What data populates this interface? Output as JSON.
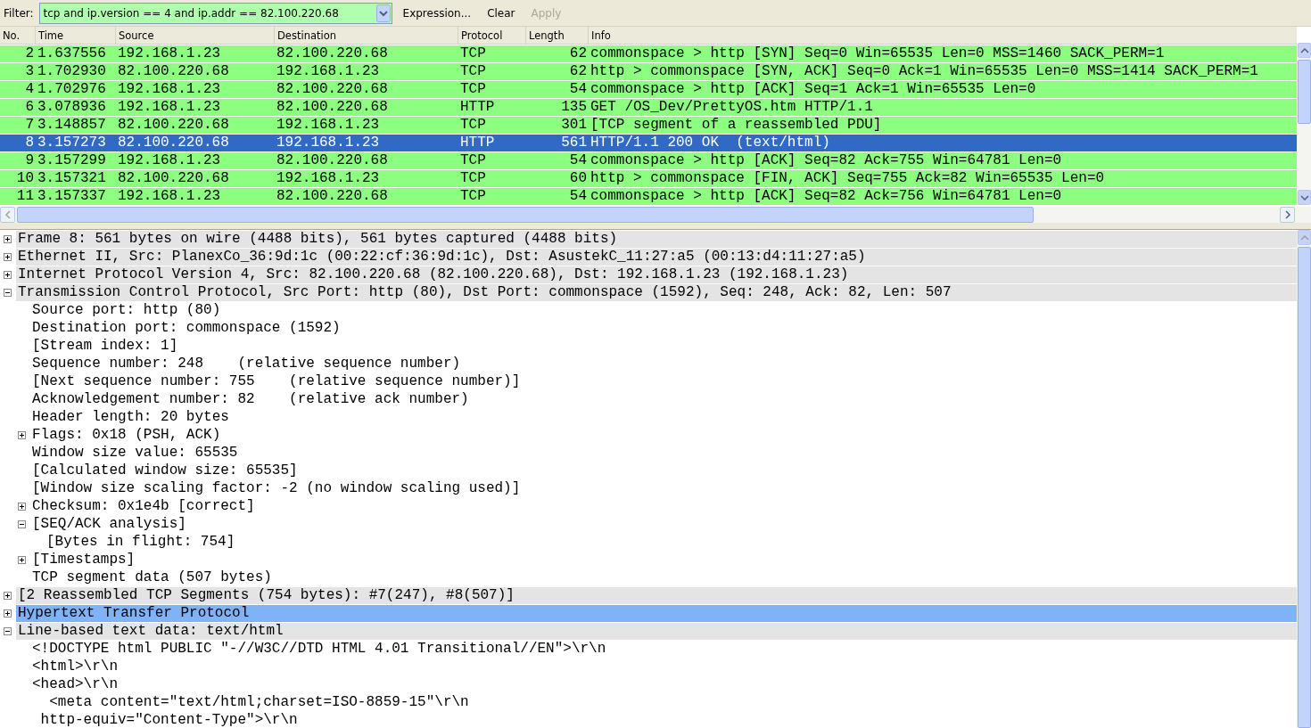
{
  "filter": {
    "label": "Filter:",
    "value": "tcp and ip.version == 4 and ip.addr == 82.100.220.68",
    "buttons": [
      {
        "label": "Expression...",
        "disabled": false
      },
      {
        "label": "Clear",
        "disabled": false
      },
      {
        "label": "Apply",
        "disabled": true
      }
    ]
  },
  "packet_list": {
    "columns": [
      "No.",
      "Time",
      "Source",
      "Destination",
      "Protocol",
      "Length",
      "Info"
    ],
    "rows": [
      {
        "no": "2",
        "time": "1.637556",
        "source": "192.168.1.23",
        "destination": "82.100.220.68",
        "protocol": "TCP",
        "length": "62",
        "info": "commonspace > http [SYN] Seq=0 Win=65535 Len=0 MSS=1460 SACK_PERM=1",
        "selected": false
      },
      {
        "no": "3",
        "time": "1.702930",
        "source": "82.100.220.68",
        "destination": "192.168.1.23",
        "protocol": "TCP",
        "length": "62",
        "info": "http > commonspace [SYN, ACK] Seq=0 Ack=1 Win=65535 Len=0 MSS=1414 SACK_PERM=1",
        "selected": false
      },
      {
        "no": "4",
        "time": "1.702976",
        "source": "192.168.1.23",
        "destination": "82.100.220.68",
        "protocol": "TCP",
        "length": "54",
        "info": "commonspace > http [ACK] Seq=1 Ack=1 Win=65535 Len=0",
        "selected": false
      },
      {
        "no": "6",
        "time": "3.078936",
        "source": "192.168.1.23",
        "destination": "82.100.220.68",
        "protocol": "HTTP",
        "length": "135",
        "info": "GET /OS_Dev/PrettyOS.htm HTTP/1.1",
        "selected": false
      },
      {
        "no": "7",
        "time": "3.148857",
        "source": "82.100.220.68",
        "destination": "192.168.1.23",
        "protocol": "TCP",
        "length": "301",
        "info": "[TCP segment of a reassembled PDU]",
        "selected": false
      },
      {
        "no": "8",
        "time": "3.157273",
        "source": "82.100.220.68",
        "destination": "192.168.1.23",
        "protocol": "HTTP",
        "length": "561",
        "info": "HTTP/1.1 200 OK  (text/html)",
        "selected": true
      },
      {
        "no": "9",
        "time": "3.157299",
        "source": "192.168.1.23",
        "destination": "82.100.220.68",
        "protocol": "TCP",
        "length": "54",
        "info": "commonspace > http [ACK] Seq=82 Ack=755 Win=64781 Len=0",
        "selected": false
      },
      {
        "no": "10",
        "time": "3.157321",
        "source": "82.100.220.68",
        "destination": "192.168.1.23",
        "protocol": "TCP",
        "length": "60",
        "info": "http > commonspace [FIN, ACK] Seq=755 Ack=82 Win=65535 Len=0",
        "selected": false
      },
      {
        "no": "11",
        "time": "3.157337",
        "source": "192.168.1.23",
        "destination": "82.100.220.68",
        "protocol": "TCP",
        "length": "54",
        "info": "commonspace > http [ACK] Seq=82 Ack=756 Win=64781 Len=0",
        "selected": false
      }
    ]
  },
  "details": {
    "tree": [
      {
        "kind": "branch",
        "expanded": false,
        "selected": false,
        "text": "Frame 8: 561 bytes on wire (4488 bits), 561 bytes captured (4488 bits)"
      },
      {
        "kind": "branch",
        "expanded": false,
        "selected": false,
        "text": "Ethernet II, Src: PlanexCo_36:9d:1c (00:22:cf:36:9d:1c), Dst: AsustekC_11:27:a5 (00:13:d4:11:27:a5)"
      },
      {
        "kind": "branch",
        "expanded": false,
        "selected": false,
        "text": "Internet Protocol Version 4, Src: 82.100.220.68 (82.100.220.68), Dst: 192.168.1.23 (192.168.1.23)"
      },
      {
        "kind": "branch",
        "expanded": true,
        "selected": false,
        "text": "Transmission Control Protocol, Src Port: http (80), Dst Port: commonspace (1592), Seq: 248, Ack: 82, Len: 507",
        "children": [
          {
            "kind": "leaf",
            "selected": false,
            "text": "Source port: http (80)"
          },
          {
            "kind": "leaf",
            "selected": false,
            "text": "Destination port: commonspace (1592)"
          },
          {
            "kind": "leaf",
            "selected": false,
            "text": "[Stream index: 1]"
          },
          {
            "kind": "leaf",
            "selected": false,
            "text": "Sequence number: 248    (relative sequence number)"
          },
          {
            "kind": "leaf",
            "selected": false,
            "text": "[Next sequence number: 755    (relative sequence number)]"
          },
          {
            "kind": "leaf",
            "selected": false,
            "text": "Acknowledgement number: 82    (relative ack number)"
          },
          {
            "kind": "leaf",
            "selected": false,
            "text": "Header length: 20 bytes"
          },
          {
            "kind": "branch",
            "expanded": false,
            "selected": false,
            "text": "Flags: 0x18 (PSH, ACK)"
          },
          {
            "kind": "leaf",
            "selected": false,
            "text": "Window size value: 65535"
          },
          {
            "kind": "leaf",
            "selected": false,
            "text": "[Calculated window size: 65535]"
          },
          {
            "kind": "leaf",
            "selected": false,
            "text": "[Window size scaling factor: -2 (no window scaling used)]"
          },
          {
            "kind": "branch",
            "expanded": false,
            "selected": false,
            "text": "Checksum: 0x1e4b [correct]"
          },
          {
            "kind": "branch",
            "expanded": true,
            "selected": false,
            "text": "[SEQ/ACK analysis]",
            "children": [
              {
                "kind": "leaf",
                "selected": false,
                "text": "[Bytes in flight: 754]"
              }
            ]
          },
          {
            "kind": "branch",
            "expanded": false,
            "selected": false,
            "text": "[Timestamps]"
          },
          {
            "kind": "leaf",
            "selected": false,
            "text": "TCP segment data (507 bytes)"
          }
        ]
      },
      {
        "kind": "branch",
        "expanded": false,
        "selected": false,
        "text": "[2 Reassembled TCP Segments (754 bytes): #7(247), #8(507)]"
      },
      {
        "kind": "branch",
        "expanded": false,
        "selected": true,
        "text": "Hypertext Transfer Protocol"
      },
      {
        "kind": "branch",
        "expanded": true,
        "selected": false,
        "text": "Line-based text data: text/html",
        "children": [
          {
            "kind": "leaf",
            "selected": false,
            "text": "<!DOCTYPE html PUBLIC \"-//W3C//DTD HTML 4.01 Transitional//EN\">\\r\\n"
          },
          {
            "kind": "leaf",
            "selected": false,
            "text": "<html>\\r\\n"
          },
          {
            "kind": "leaf",
            "selected": false,
            "text": "<head>\\r\\n"
          },
          {
            "kind": "leaf",
            "selected": false,
            "text": "  <meta content=\"text/html;charset=ISO-8859-15\"\\r\\n"
          },
          {
            "kind": "leaf",
            "selected": false,
            "text": " http-equiv=\"Content-Type\">\\r\\n"
          }
        ]
      }
    ]
  }
}
